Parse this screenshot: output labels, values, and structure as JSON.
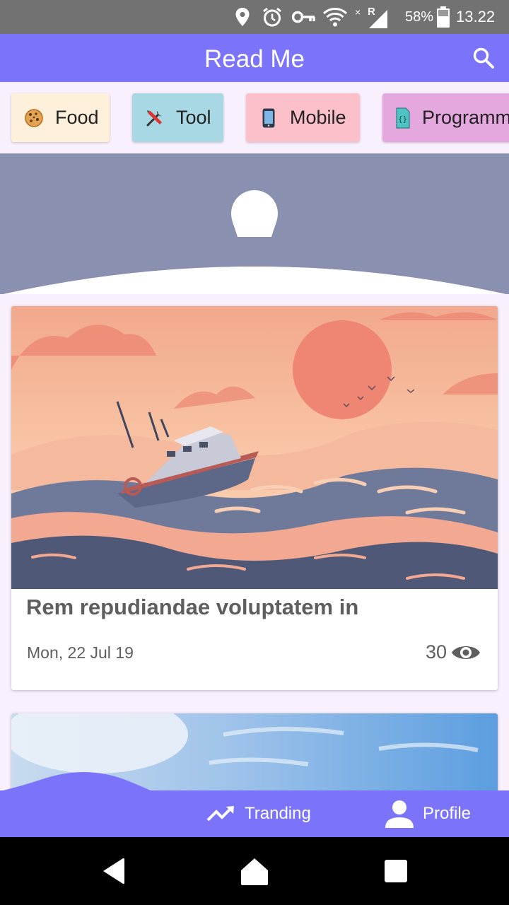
{
  "status_bar": {
    "battery": "58%",
    "time": "13.22",
    "icons": [
      "location-icon",
      "alarm-icon",
      "vpn-key-icon",
      "wifi-icon",
      "signal-icon",
      "battery-icon"
    ]
  },
  "app_bar": {
    "title": "Read Me",
    "search_icon": "search-icon"
  },
  "categories": [
    {
      "label": "Food",
      "icon": "cookie-icon",
      "color": "#fff0dc"
    },
    {
      "label": "Tool",
      "icon": "tools-icon",
      "color": "#a8d8e3"
    },
    {
      "label": "Mobile",
      "icon": "mobile-phone-icon",
      "color": "#fcc0ca"
    },
    {
      "label": "Programming",
      "icon": "code-file-icon",
      "color": "#e4a8de"
    }
  ],
  "articles": [
    {
      "title": "Rem repudiandae voluptatem in",
      "date": "Mon, 22 Jul 19",
      "views": "30"
    }
  ],
  "bottom_nav": {
    "tranding": "Tranding",
    "profile": "Profile"
  },
  "colors": {
    "primary": "#7b74fb",
    "background": "#f9f0fd",
    "hero": "#8a90b0",
    "status_bar": "#727272"
  }
}
